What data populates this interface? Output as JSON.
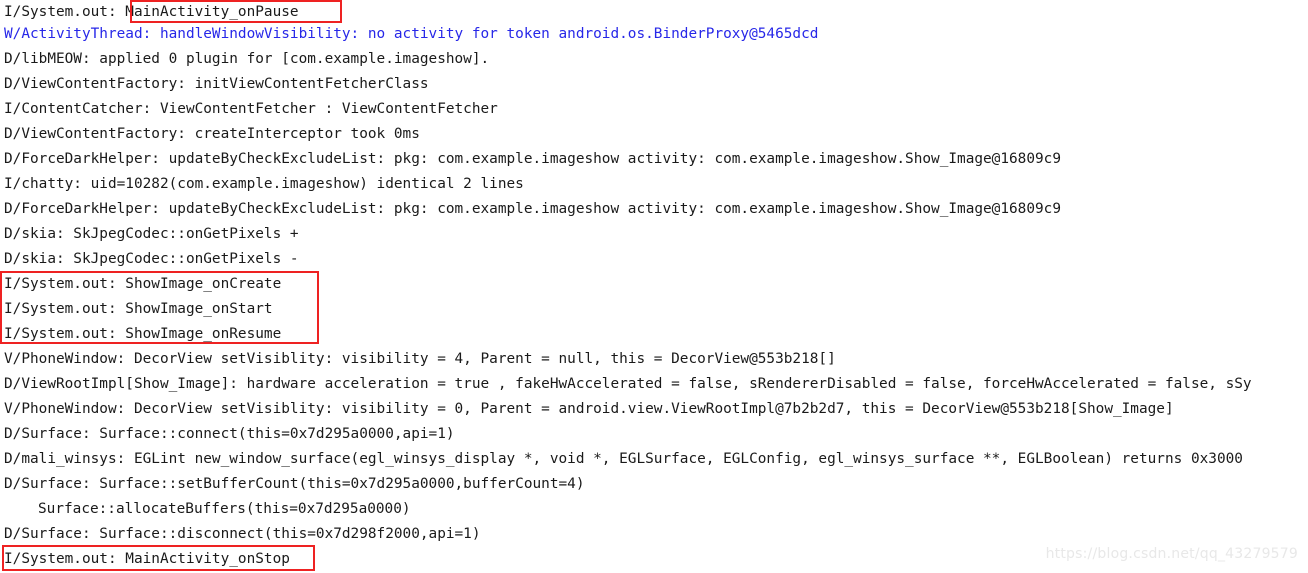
{
  "console": {
    "title": "Android Logcat output",
    "watermark": "https://blog.csdn.net/qq_43279579",
    "colors": {
      "background": "#ffffff",
      "text_default": "#1a1a1a",
      "text_warning": "#2727e8",
      "highlight_box": "#ee2222",
      "watermark": "#e8e8e8"
    },
    "lines": [
      {
        "level": "I",
        "text": "I/System.out: MainActivity_onPause"
      },
      {
        "level": "W",
        "text": "W/ActivityThread: handleWindowVisibility: no activity for token android.os.BinderProxy@5465dcd"
      },
      {
        "level": "D",
        "text": "D/libMEOW: applied 0 plugin for [com.example.imageshow]."
      },
      {
        "level": "D",
        "text": "D/ViewContentFactory: initViewContentFetcherClass"
      },
      {
        "level": "I",
        "text": "I/ContentCatcher: ViewContentFetcher : ViewContentFetcher"
      },
      {
        "level": "D",
        "text": "D/ViewContentFactory: createInterceptor took 0ms"
      },
      {
        "level": "D",
        "text": "D/ForceDarkHelper: updateByCheckExcludeList: pkg: com.example.imageshow activity: com.example.imageshow.Show_Image@16809c9"
      },
      {
        "level": "I",
        "text": "I/chatty: uid=10282(com.example.imageshow) identical 2 lines"
      },
      {
        "level": "D",
        "text": "D/ForceDarkHelper: updateByCheckExcludeList: pkg: com.example.imageshow activity: com.example.imageshow.Show_Image@16809c9"
      },
      {
        "level": "D",
        "text": "D/skia: SkJpegCodec::onGetPixels +"
      },
      {
        "level": "D",
        "text": "D/skia: SkJpegCodec::onGetPixels -"
      },
      {
        "level": "I",
        "text": "I/System.out: ShowImage_onCreate"
      },
      {
        "level": "I",
        "text": "I/System.out: ShowImage_onStart"
      },
      {
        "level": "I",
        "text": "I/System.out: ShowImage_onResume"
      },
      {
        "level": "V",
        "text": "V/PhoneWindow: DecorView setVisiblity: visibility = 4, Parent = null, this = DecorView@553b218[]"
      },
      {
        "level": "D",
        "text": "D/ViewRootImpl[Show_Image]: hardware acceleration = true , fakeHwAccelerated = false, sRendererDisabled = false, forceHwAccelerated = false, sSy"
      },
      {
        "level": "V",
        "text": "V/PhoneWindow: DecorView setVisiblity: visibility = 0, Parent = android.view.ViewRootImpl@7b2b2d7, this = DecorView@553b218[Show_Image]"
      },
      {
        "level": "D",
        "text": "D/Surface: Surface::connect(this=0x7d295a0000,api=1)"
      },
      {
        "level": "D",
        "text": "D/mali_winsys: EGLint new_window_surface(egl_winsys_display *, void *, EGLSurface, EGLConfig, egl_winsys_surface **, EGLBoolean) returns 0x3000"
      },
      {
        "level": "D",
        "text": "D/Surface: Surface::setBufferCount(this=0x7d295a0000,bufferCount=4)"
      },
      {
        "level": "D",
        "text": "Surface::allocateBuffers(this=0x7d295a0000)",
        "indented": true
      },
      {
        "level": "D",
        "text": "D/Surface: Surface::disconnect(this=0x7d298f2000,api=1)"
      },
      {
        "level": "I",
        "text": "I/System.out: MainActivity_onStop"
      }
    ],
    "highlights": [
      {
        "name": "highlight-main-activity-on-pause",
        "target_text": "MainActivity_onPause"
      },
      {
        "name": "highlight-show-image-lifecycle",
        "target_text": "ShowImage_onCreate / ShowImage_onStart / ShowImage_onResume"
      },
      {
        "name": "highlight-main-activity-on-stop",
        "target_text": "I/System.out: MainActivity_onStop"
      }
    ]
  }
}
